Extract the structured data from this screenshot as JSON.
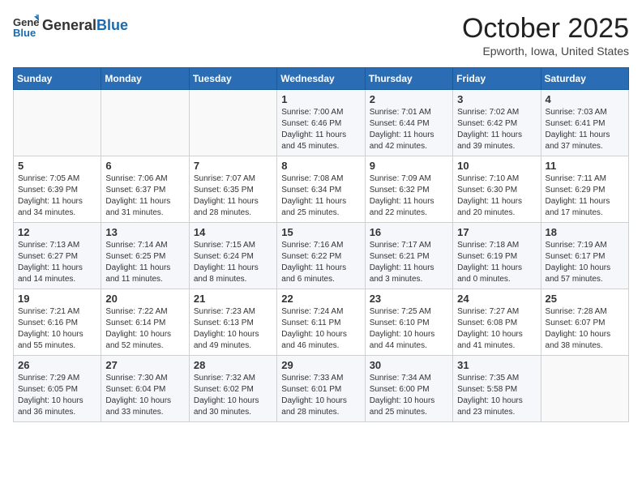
{
  "header": {
    "logo_general": "General",
    "logo_blue": "Blue",
    "month": "October 2025",
    "location": "Epworth, Iowa, United States"
  },
  "days_of_week": [
    "Sunday",
    "Monday",
    "Tuesday",
    "Wednesday",
    "Thursday",
    "Friday",
    "Saturday"
  ],
  "weeks": [
    [
      {
        "day": "",
        "info": ""
      },
      {
        "day": "",
        "info": ""
      },
      {
        "day": "",
        "info": ""
      },
      {
        "day": "1",
        "info": "Sunrise: 7:00 AM\nSunset: 6:46 PM\nDaylight: 11 hours and 45 minutes."
      },
      {
        "day": "2",
        "info": "Sunrise: 7:01 AM\nSunset: 6:44 PM\nDaylight: 11 hours and 42 minutes."
      },
      {
        "day": "3",
        "info": "Sunrise: 7:02 AM\nSunset: 6:42 PM\nDaylight: 11 hours and 39 minutes."
      },
      {
        "day": "4",
        "info": "Sunrise: 7:03 AM\nSunset: 6:41 PM\nDaylight: 11 hours and 37 minutes."
      }
    ],
    [
      {
        "day": "5",
        "info": "Sunrise: 7:05 AM\nSunset: 6:39 PM\nDaylight: 11 hours and 34 minutes."
      },
      {
        "day": "6",
        "info": "Sunrise: 7:06 AM\nSunset: 6:37 PM\nDaylight: 11 hours and 31 minutes."
      },
      {
        "day": "7",
        "info": "Sunrise: 7:07 AM\nSunset: 6:35 PM\nDaylight: 11 hours and 28 minutes."
      },
      {
        "day": "8",
        "info": "Sunrise: 7:08 AM\nSunset: 6:34 PM\nDaylight: 11 hours and 25 minutes."
      },
      {
        "day": "9",
        "info": "Sunrise: 7:09 AM\nSunset: 6:32 PM\nDaylight: 11 hours and 22 minutes."
      },
      {
        "day": "10",
        "info": "Sunrise: 7:10 AM\nSunset: 6:30 PM\nDaylight: 11 hours and 20 minutes."
      },
      {
        "day": "11",
        "info": "Sunrise: 7:11 AM\nSunset: 6:29 PM\nDaylight: 11 hours and 17 minutes."
      }
    ],
    [
      {
        "day": "12",
        "info": "Sunrise: 7:13 AM\nSunset: 6:27 PM\nDaylight: 11 hours and 14 minutes."
      },
      {
        "day": "13",
        "info": "Sunrise: 7:14 AM\nSunset: 6:25 PM\nDaylight: 11 hours and 11 minutes."
      },
      {
        "day": "14",
        "info": "Sunrise: 7:15 AM\nSunset: 6:24 PM\nDaylight: 11 hours and 8 minutes."
      },
      {
        "day": "15",
        "info": "Sunrise: 7:16 AM\nSunset: 6:22 PM\nDaylight: 11 hours and 6 minutes."
      },
      {
        "day": "16",
        "info": "Sunrise: 7:17 AM\nSunset: 6:21 PM\nDaylight: 11 hours and 3 minutes."
      },
      {
        "day": "17",
        "info": "Sunrise: 7:18 AM\nSunset: 6:19 PM\nDaylight: 11 hours and 0 minutes."
      },
      {
        "day": "18",
        "info": "Sunrise: 7:19 AM\nSunset: 6:17 PM\nDaylight: 10 hours and 57 minutes."
      }
    ],
    [
      {
        "day": "19",
        "info": "Sunrise: 7:21 AM\nSunset: 6:16 PM\nDaylight: 10 hours and 55 minutes."
      },
      {
        "day": "20",
        "info": "Sunrise: 7:22 AM\nSunset: 6:14 PM\nDaylight: 10 hours and 52 minutes."
      },
      {
        "day": "21",
        "info": "Sunrise: 7:23 AM\nSunset: 6:13 PM\nDaylight: 10 hours and 49 minutes."
      },
      {
        "day": "22",
        "info": "Sunrise: 7:24 AM\nSunset: 6:11 PM\nDaylight: 10 hours and 46 minutes."
      },
      {
        "day": "23",
        "info": "Sunrise: 7:25 AM\nSunset: 6:10 PM\nDaylight: 10 hours and 44 minutes."
      },
      {
        "day": "24",
        "info": "Sunrise: 7:27 AM\nSunset: 6:08 PM\nDaylight: 10 hours and 41 minutes."
      },
      {
        "day": "25",
        "info": "Sunrise: 7:28 AM\nSunset: 6:07 PM\nDaylight: 10 hours and 38 minutes."
      }
    ],
    [
      {
        "day": "26",
        "info": "Sunrise: 7:29 AM\nSunset: 6:05 PM\nDaylight: 10 hours and 36 minutes."
      },
      {
        "day": "27",
        "info": "Sunrise: 7:30 AM\nSunset: 6:04 PM\nDaylight: 10 hours and 33 minutes."
      },
      {
        "day": "28",
        "info": "Sunrise: 7:32 AM\nSunset: 6:02 PM\nDaylight: 10 hours and 30 minutes."
      },
      {
        "day": "29",
        "info": "Sunrise: 7:33 AM\nSunset: 6:01 PM\nDaylight: 10 hours and 28 minutes."
      },
      {
        "day": "30",
        "info": "Sunrise: 7:34 AM\nSunset: 6:00 PM\nDaylight: 10 hours and 25 minutes."
      },
      {
        "day": "31",
        "info": "Sunrise: 7:35 AM\nSunset: 5:58 PM\nDaylight: 10 hours and 23 minutes."
      },
      {
        "day": "",
        "info": ""
      }
    ]
  ]
}
